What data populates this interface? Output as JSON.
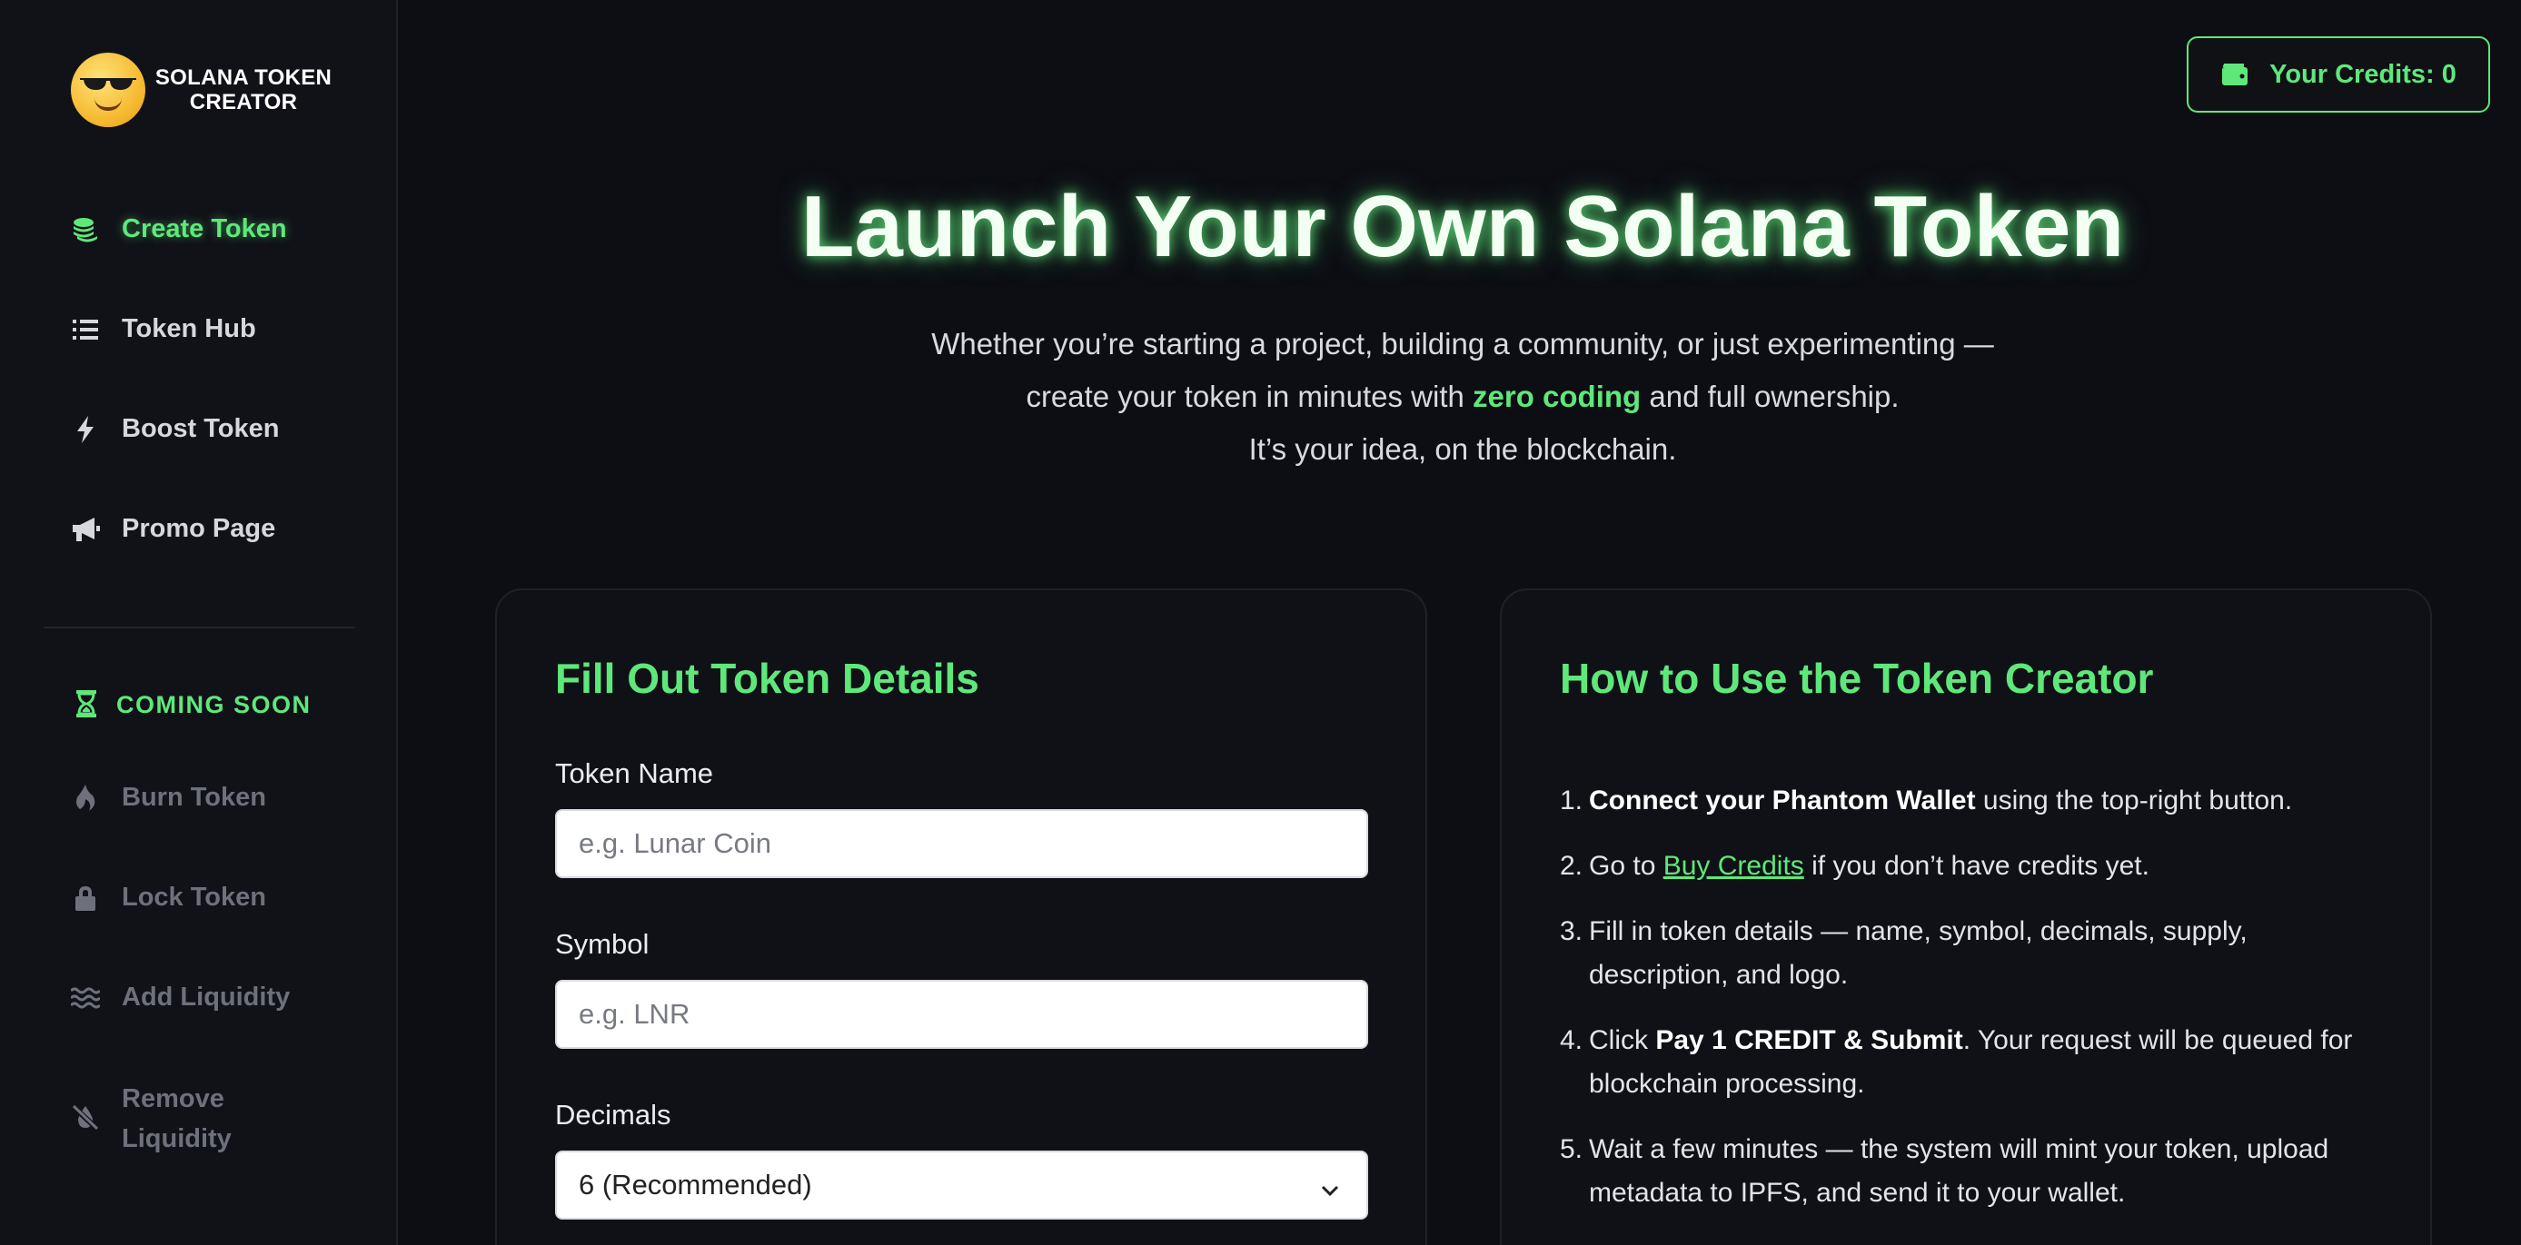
{
  "brand": {
    "name_line1": "SOLANA TOKEN",
    "name_line2": "CREATOR",
    "logo_icon": "sunglasses-emoji-icon"
  },
  "sidebar": {
    "items": [
      {
        "label": "Create Token",
        "icon": "coins-stack-icon",
        "active": true
      },
      {
        "label": "Token Hub",
        "icon": "list-icon",
        "active": false
      },
      {
        "label": "Boost Token",
        "icon": "bolt-icon",
        "active": false
      },
      {
        "label": "Promo Page",
        "icon": "megaphone-icon",
        "active": false
      }
    ],
    "coming_soon": {
      "heading": "COMING SOON",
      "icon": "hourglass-icon",
      "items": [
        {
          "label": "Burn Token",
          "icon": "fire-icon"
        },
        {
          "label": "Lock Token",
          "icon": "lock-icon"
        },
        {
          "label": "Add Liquidity",
          "icon": "water-waves-icon"
        },
        {
          "label_line1": "Remove",
          "label_line2": "Liquidity",
          "icon": "water-off-icon"
        }
      ]
    }
  },
  "header": {
    "credits_label": "Your Credits: 0",
    "credits_icon": "wallet-icon"
  },
  "hero": {
    "title": "Launch Your Own Solana Token",
    "line1": "Whether you’re starting a project, building a community, or just experimenting —",
    "line2_before": "create your token in minutes with ",
    "line2_highlight": "zero coding",
    "line2_after": " and full ownership.",
    "line3": "It’s your idea, on the blockchain."
  },
  "form": {
    "title": "Fill Out Token Details",
    "token_name": {
      "label": "Token Name",
      "placeholder": "e.g. Lunar Coin",
      "value": ""
    },
    "symbol": {
      "label": "Symbol",
      "placeholder": "e.g. LNR",
      "value": ""
    },
    "decimals": {
      "label": "Decimals",
      "selected": "6 (Recommended)"
    }
  },
  "guide": {
    "title": "How to Use the Token Creator",
    "steps": [
      {
        "num": "1.",
        "bold": "Connect your Phantom Wallet",
        "text": " using the top-right button."
      },
      {
        "num": "2.",
        "before": "Go to ",
        "link": "Buy Credits",
        "after": " if you don’t have credits yet."
      },
      {
        "num": "3.",
        "text": "Fill in token details — name, symbol, decimals, supply, description, and logo."
      },
      {
        "num": "4.",
        "before": "Click ",
        "bold": "Pay 1 CREDIT & Submit",
        "after": ". Your request will be queued for blockchain processing."
      },
      {
        "num": "5.",
        "text": "Wait a few minutes — the system will mint your token, upload metadata to IPFS, and send it to your wallet."
      }
    ]
  },
  "colors": {
    "accent": "#5ee87a",
    "background": "#0d0e14",
    "sidebar": "#111218",
    "card": "#101117"
  }
}
